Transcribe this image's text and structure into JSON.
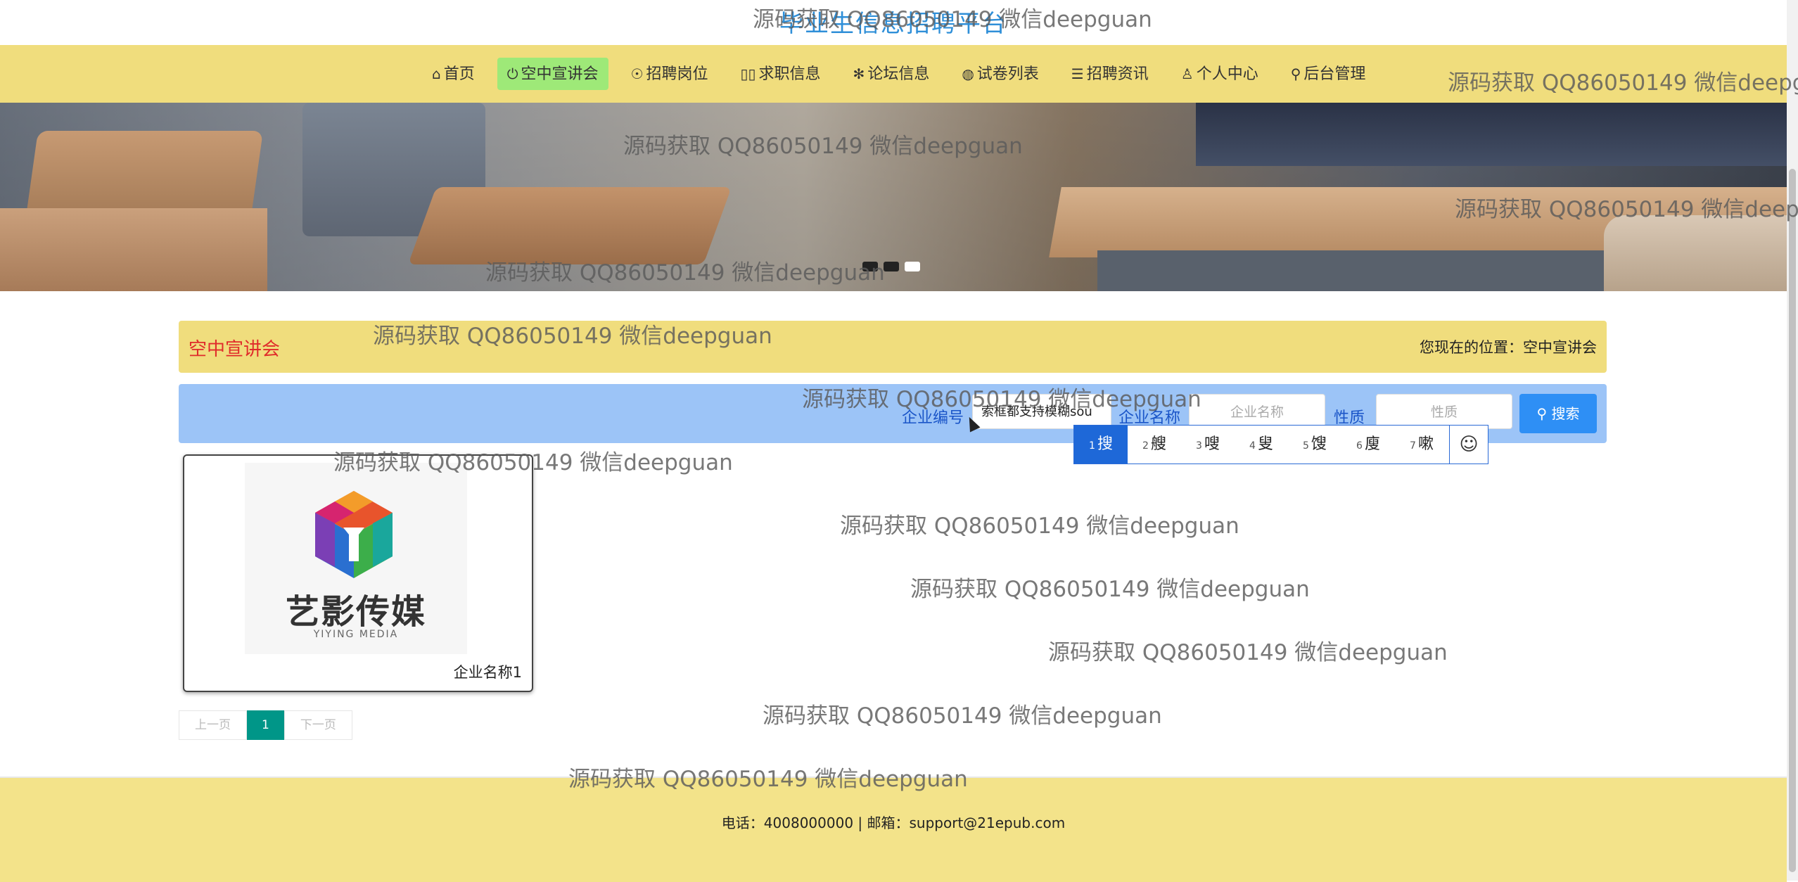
{
  "site": {
    "title": "毕业生信息招聘平台"
  },
  "nav": {
    "items": [
      {
        "icon": "⌂",
        "label": "首页"
      },
      {
        "icon": "⏻",
        "label": "空中宣讲会"
      },
      {
        "icon": "☉",
        "label": "招聘岗位"
      },
      {
        "icon": "▯▯",
        "label": "求职信息"
      },
      {
        "icon": "✻",
        "label": "论坛信息"
      },
      {
        "icon": "◍",
        "label": "试卷列表"
      },
      {
        "icon": "☰",
        "label": "招聘资讯"
      },
      {
        "icon": "♙",
        "label": "个人中心"
      },
      {
        "icon": "⚲",
        "label": "后台管理"
      }
    ]
  },
  "breadcrumb": {
    "title": "空中宣讲会",
    "position": "您现在的位置：空中宣讲会"
  },
  "search": {
    "field1_label": "企业编号",
    "field1_value": "索框都支持模糊sou",
    "field2_label": "企业名称",
    "field2_placeholder": "企业名称",
    "field3_label": "性质",
    "field3_placeholder": "性质",
    "button_label": "搜索"
  },
  "ime": {
    "candidates": [
      {
        "n": "1",
        "c": "搜"
      },
      {
        "n": "2",
        "c": "艘"
      },
      {
        "n": "3",
        "c": "嗖"
      },
      {
        "n": "4",
        "c": "叟"
      },
      {
        "n": "5",
        "c": "馊"
      },
      {
        "n": "6",
        "c": "廋"
      },
      {
        "n": "7",
        "c": "嗽"
      }
    ],
    "emoji": "☺"
  },
  "cards": [
    {
      "logo_cn": "艺影传媒",
      "logo_en": "YIYING MEDIA",
      "name": "企业名称1"
    }
  ],
  "pager": {
    "prev": "上一页",
    "current": "1",
    "next": "下一页"
  },
  "footer": {
    "text": "电话：4008000000 | 邮箱：support@21epub.com"
  },
  "watermark": {
    "text": "源码获取 QQ86050149 微信deepguan"
  }
}
